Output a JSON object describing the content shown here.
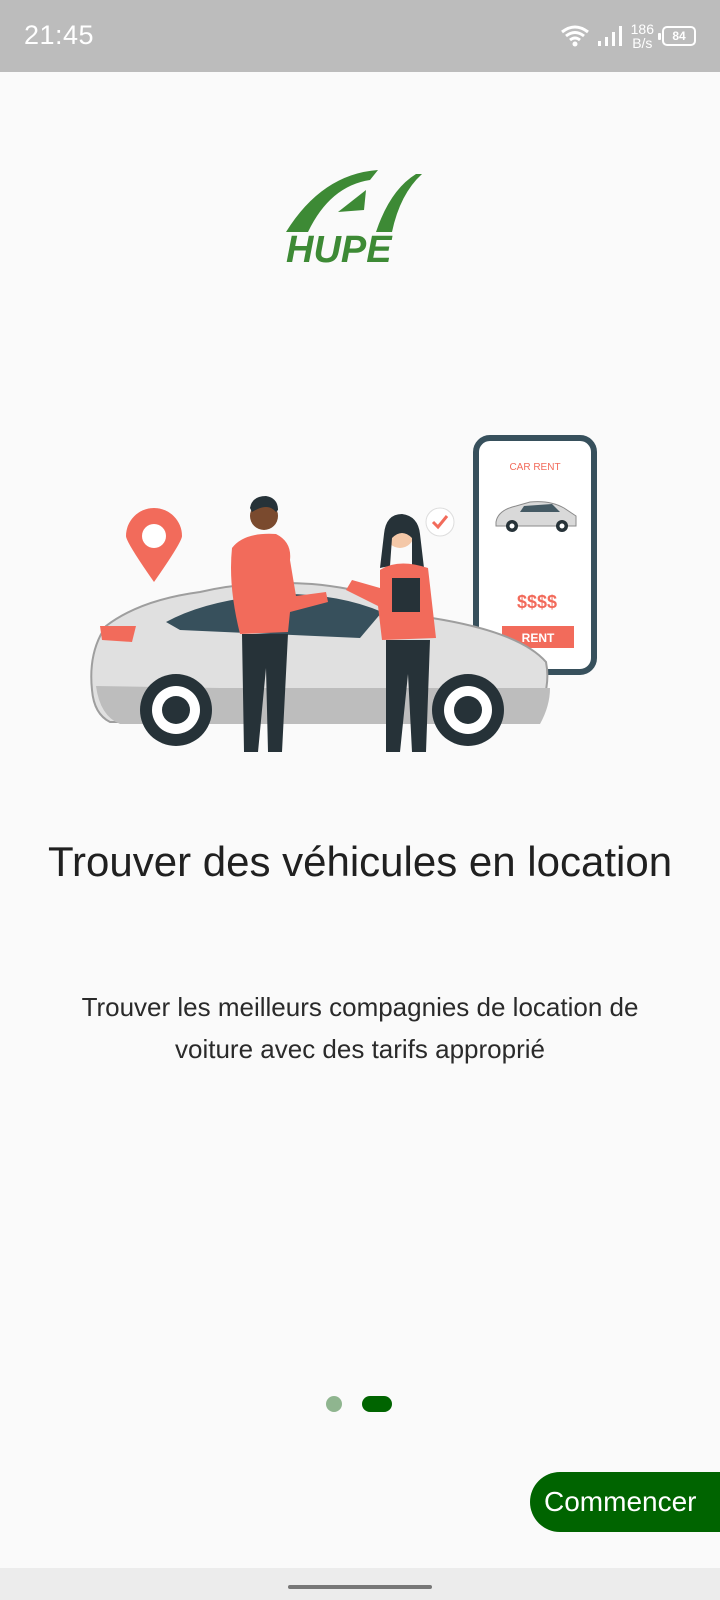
{
  "status_bar": {
    "time": "21:45",
    "net_speed_value": "186",
    "net_speed_unit": "B/s",
    "battery": "84",
    "icons": [
      "wifi-icon",
      "signal-icon",
      "battery-icon"
    ]
  },
  "logo": {
    "text": "HUPE"
  },
  "illustration": {
    "phone_header": "CAR RENT",
    "price": "$$$$",
    "rent_button": "RENT"
  },
  "onboarding": {
    "title": "Trouver des véhicules en location",
    "subtitle": "Trouver les meilleurs compagnies de location de voiture avec des tarifs approprié",
    "page_count": 2,
    "current_page": 2
  },
  "actions": {
    "start_label": "Commencer"
  },
  "colors": {
    "accent": "#006400",
    "dot_inactive": "#8fb58f",
    "logo_green": "#3d8a35",
    "illustration_coral": "#f26b5b",
    "illustration_dark": "#263238"
  }
}
